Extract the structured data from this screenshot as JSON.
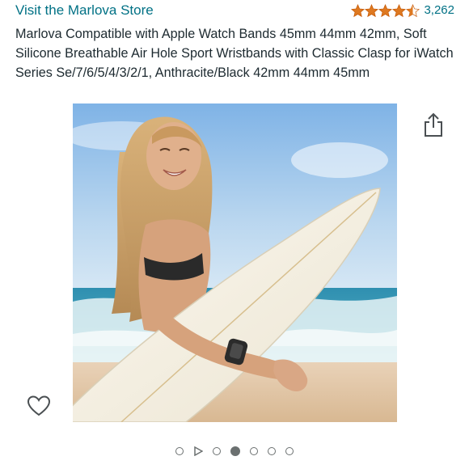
{
  "store": {
    "link_label": "Visit the Marlova Store"
  },
  "rating": {
    "stars": 4.5,
    "count": "3,262",
    "star_color": "#de7921"
  },
  "product": {
    "title": "Marlova Compatible with Apple Watch Bands 45mm 44mm 42mm, Soft Silicone Breathable Air Hole Sport Wristbands with Classic Clasp for iWatch Series Se/7/6/5/4/3/2/1, Anthracite/Black 42mm 44mm 45mm"
  },
  "icons": {
    "share": "share-icon",
    "favorite": "heart-icon",
    "video": "play-icon"
  },
  "gallery": {
    "slides": [
      "image",
      "video",
      "image",
      "image",
      "image",
      "image",
      "image"
    ],
    "active_index": 3
  },
  "colors": {
    "link": "#007185",
    "text": "#0f1111",
    "indicator": "#6b7070"
  }
}
